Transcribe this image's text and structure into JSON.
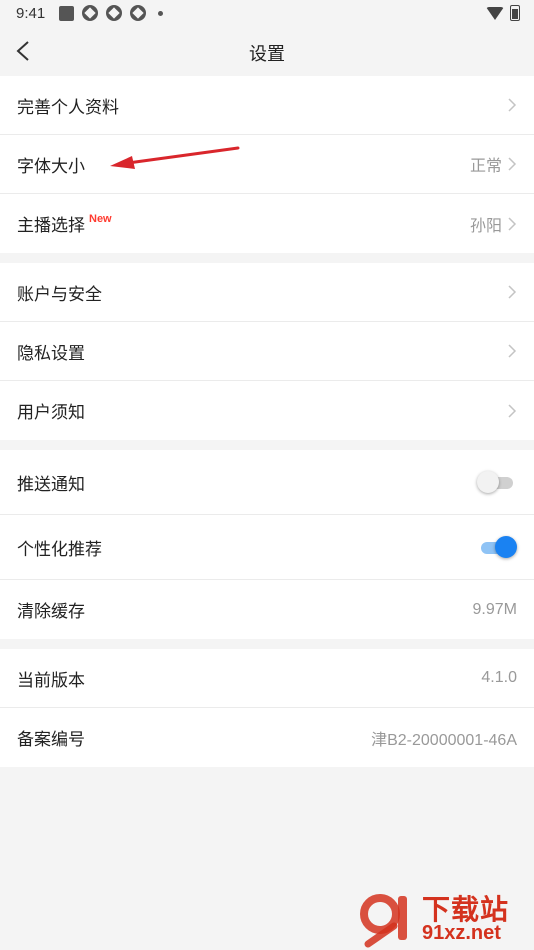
{
  "status_bar": {
    "time": "9:41"
  },
  "nav": {
    "title": "设置"
  },
  "group1": [
    {
      "label": "完善个人资料",
      "value": ""
    },
    {
      "label": "字体大小",
      "value": "正常"
    },
    {
      "label": "主播选择",
      "badge": "New",
      "value": "孙阳"
    }
  ],
  "group2": [
    {
      "label": "账户与安全"
    },
    {
      "label": "隐私设置"
    },
    {
      "label": "用户须知"
    }
  ],
  "group3": [
    {
      "label": "推送通知",
      "toggle": false
    },
    {
      "label": "个性化推荐",
      "toggle": true
    },
    {
      "label": "清除缓存",
      "value": "9.97M"
    }
  ],
  "group4": [
    {
      "label": "当前版本",
      "value": "4.1.0"
    },
    {
      "label": "备案编号",
      "value": "津B2-20000001-46A"
    }
  ],
  "watermark": {
    "title": "下载站",
    "url": "91xz.net"
  },
  "colors": {
    "toggle_on": "#1a82f2",
    "badge_new": "#ff3b30",
    "annotation_arrow": "#d9262c",
    "watermark": "#d4321e"
  }
}
